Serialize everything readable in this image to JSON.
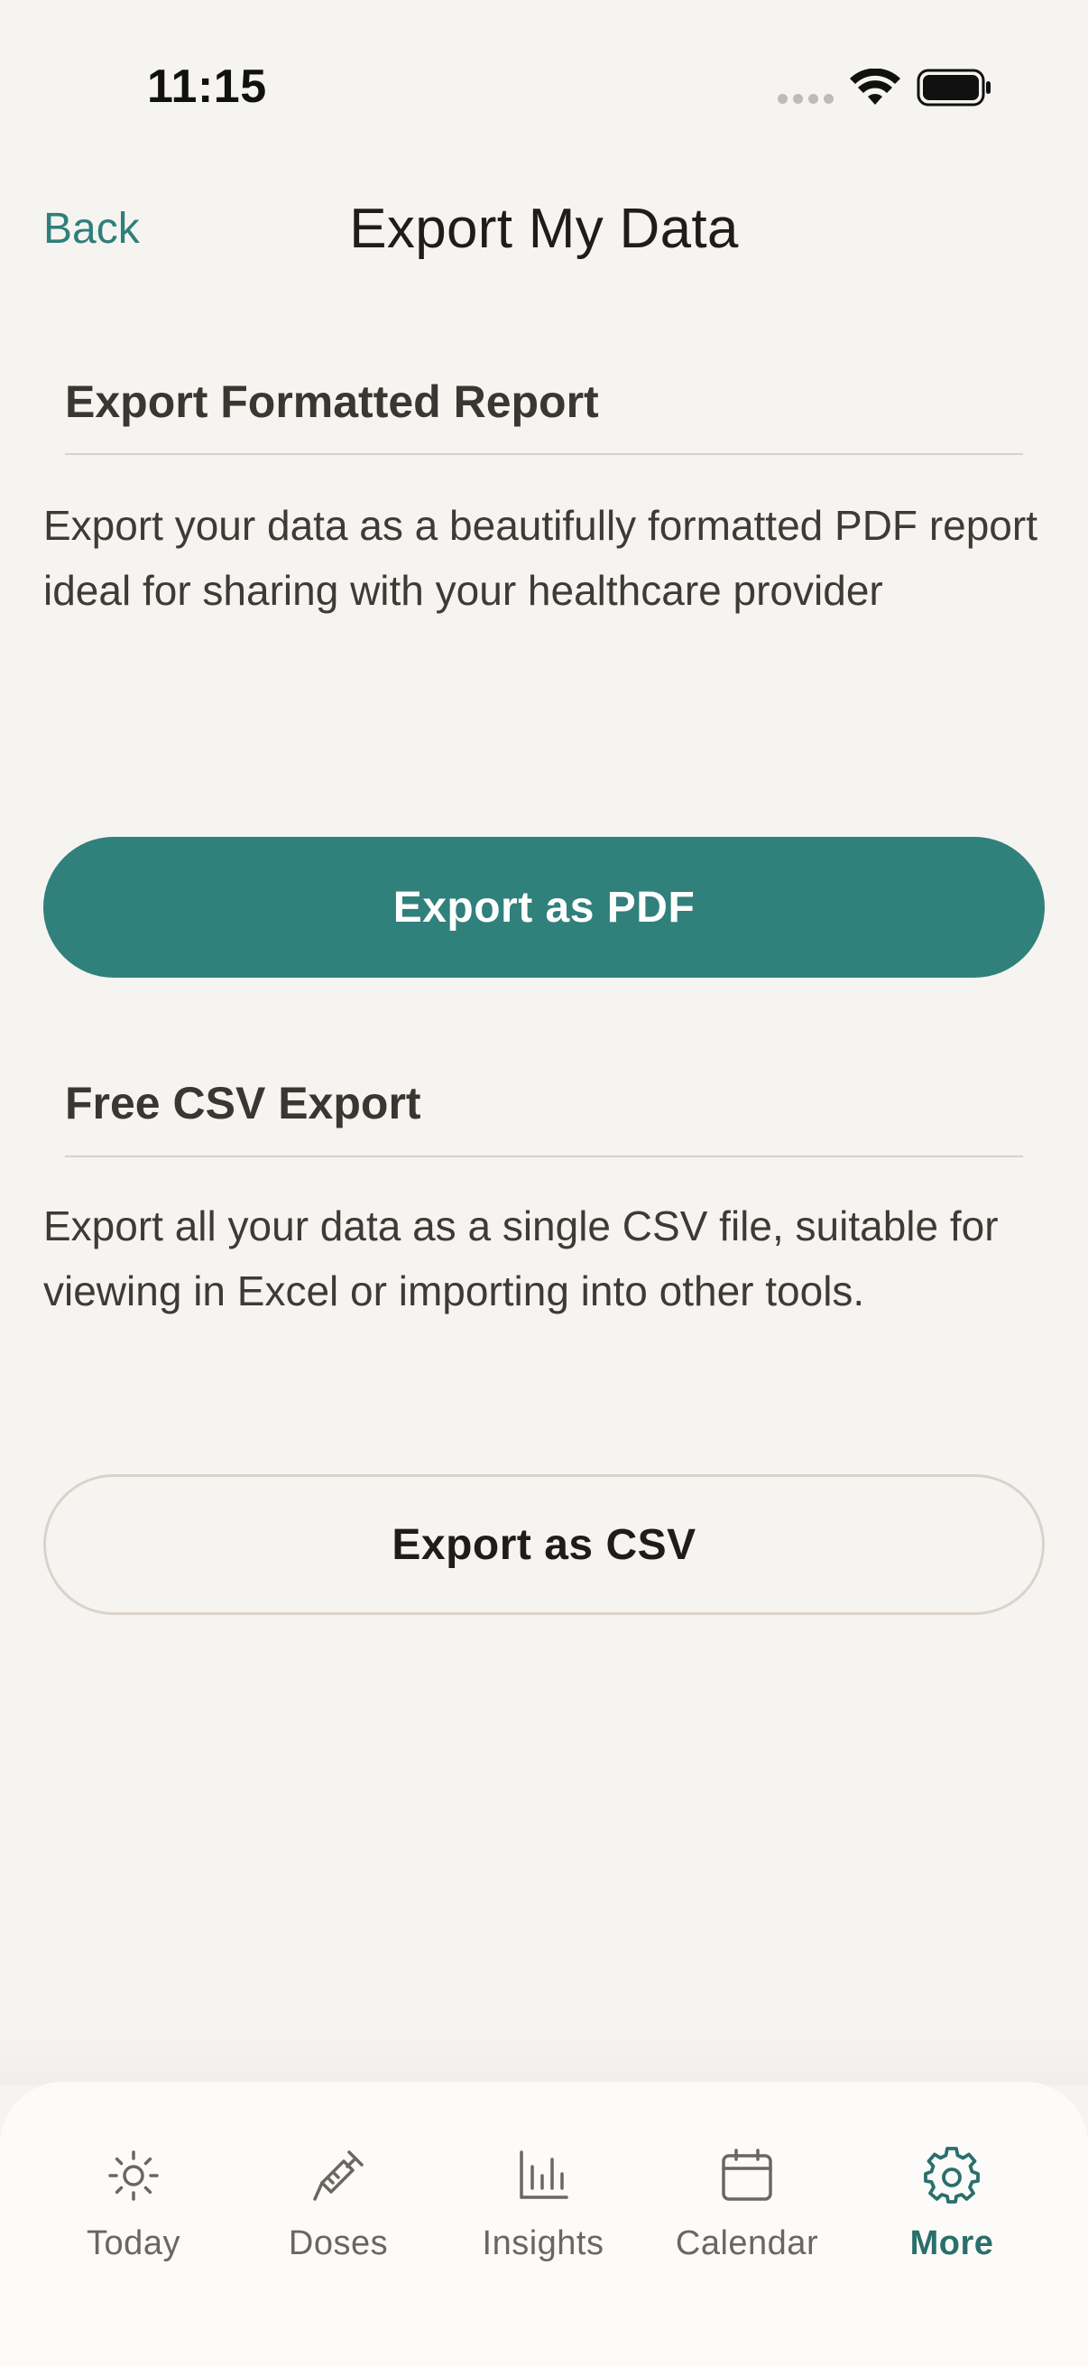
{
  "status_bar": {
    "time": "11:15"
  },
  "nav": {
    "back_label": "Back",
    "title": "Export My Data"
  },
  "sections": [
    {
      "title": "Export Formatted Report",
      "description": "Export your data as a beautifully formatted PDF report ideal for sharing with your healthcare provider",
      "button_label": "Export as PDF"
    },
    {
      "title": "Free CSV Export",
      "description": "Export all your data as a single CSV file, suitable for viewing in Excel or importing into other tools.",
      "button_label": "Export as CSV"
    }
  ],
  "tab_bar": {
    "items": [
      {
        "label": "Today",
        "icon": "sun-icon",
        "active": false
      },
      {
        "label": "Doses",
        "icon": "syringe-icon",
        "active": false
      },
      {
        "label": "Insights",
        "icon": "bar-chart-icon",
        "active": false
      },
      {
        "label": "Calendar",
        "icon": "calendar-icon",
        "active": false
      },
      {
        "label": "More",
        "icon": "gear-icon",
        "active": true
      }
    ]
  },
  "colors": {
    "accent": "#30807b",
    "background": "#f6f4f1",
    "active_tab": "#2a6f6b",
    "inactive_tab": "#6b6660"
  }
}
